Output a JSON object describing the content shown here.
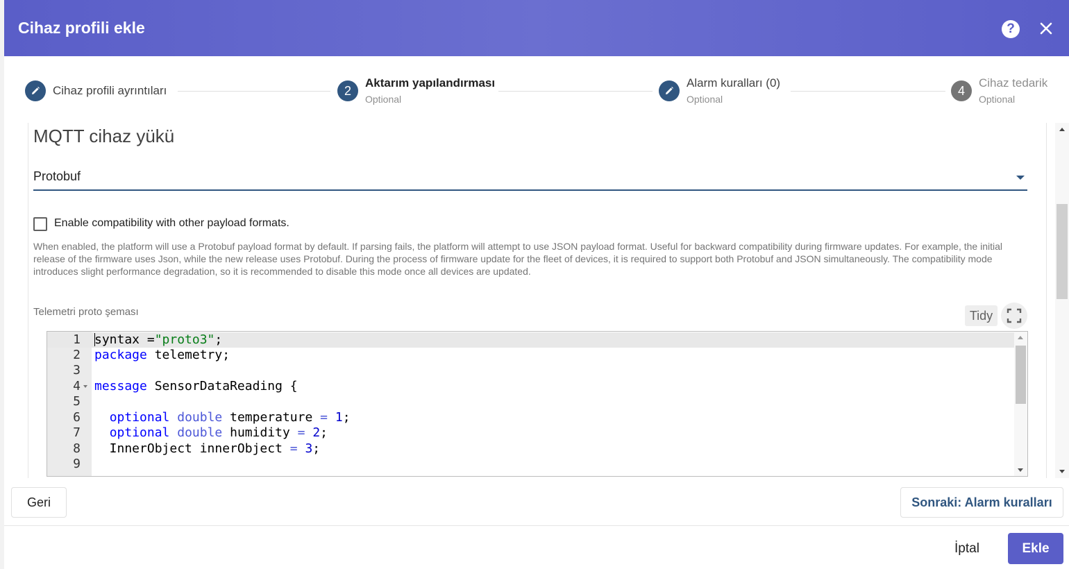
{
  "dialog": {
    "title": "Cihaz profili ekle",
    "help_icon": "help-circle-icon",
    "close_icon": "close-icon"
  },
  "stepper": {
    "steps": [
      {
        "label": "Cihaz profili ayrıntıları",
        "sublabel": "",
        "indicator": "pencil-icon",
        "state": "done"
      },
      {
        "label": "Aktarım yapılandırması",
        "sublabel": "Optional",
        "indicator": "2",
        "state": "active"
      },
      {
        "label": "Alarm kuralları (0)",
        "sublabel": "Optional",
        "indicator": "pencil-icon",
        "state": "done"
      },
      {
        "label": "Cihaz tedarik",
        "sublabel": "Optional",
        "indicator": "4",
        "state": "pending"
      }
    ]
  },
  "form": {
    "section_title": "MQTT cihaz yükü",
    "payload_select": {
      "value": "Protobuf"
    },
    "compat_checkbox": {
      "label": "Enable compatibility with other payload formats.",
      "checked": false
    },
    "compat_hint": "When enabled, the platform will use a Protobuf payload format by default. If parsing fails, the platform will attempt to use JSON payload format. Useful for backward compatibility during firmware updates. For example, the initial release of the firmware uses Json, while the new release uses Protobuf. During the process of firmware update for the fleet of devices, it is required to support both Protobuf and JSON simultaneously. The compatibility mode introduces slight performance degradation, so it is recommended to disable this mode once all devices are updated.",
    "schema_label": "Telemetri proto şeması",
    "tidy_label": "Tidy",
    "fullscreen_icon": "fullscreen-icon"
  },
  "editor": {
    "line_numbers": [
      "1",
      "2",
      "3",
      "4",
      "5",
      "6",
      "7",
      "8",
      "9"
    ],
    "lines": [
      {
        "n": "1",
        "text": "syntax =\"proto3\";"
      },
      {
        "n": "2",
        "text": "package telemetry;"
      },
      {
        "n": "3",
        "text": ""
      },
      {
        "n": "4",
        "text": "message SensorDataReading {"
      },
      {
        "n": "5",
        "text": ""
      },
      {
        "n": "6",
        "text": "  optional double temperature = 1;"
      },
      {
        "n": "7",
        "text": "  optional double humidity = 2;"
      },
      {
        "n": "8",
        "text": "  InnerObject innerObject = 3;"
      },
      {
        "n": "9",
        "text": ""
      }
    ]
  },
  "buttons": {
    "back": "Geri",
    "next": "Sonraki: Alarm kuralları",
    "cancel": "İptal",
    "add": "Ekle"
  },
  "colors": {
    "header": "#5a5ec8",
    "primary": "#305680",
    "add_button": "#5a5ec8"
  }
}
